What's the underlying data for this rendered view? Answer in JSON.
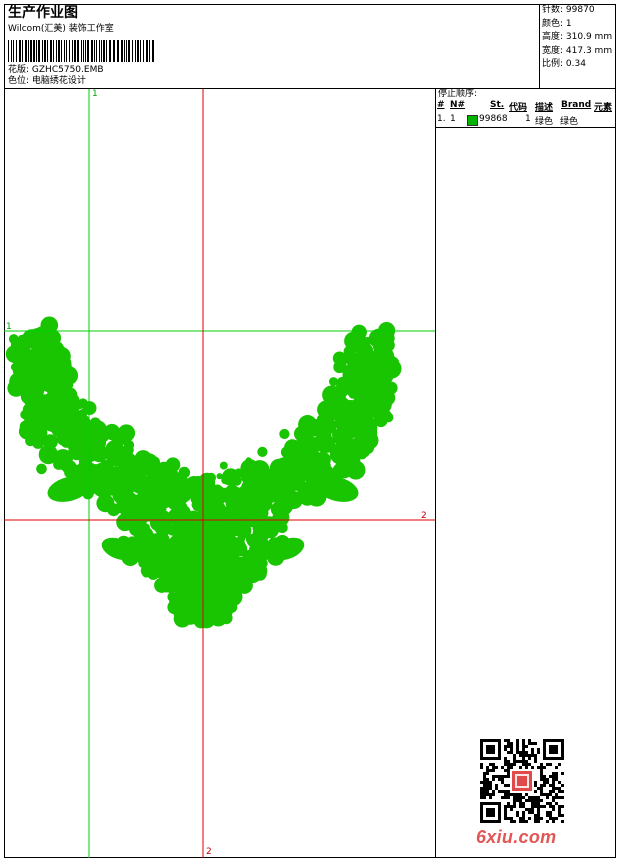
{
  "header": {
    "title": "生产作业图",
    "studio": "Wilcom(汇美) 装饰工作室",
    "pattern_label": "花版:",
    "pattern_value": "GZHC5750.EMB",
    "color_label": "色位:",
    "color_value": "电脑绣花设计"
  },
  "stats": [
    {
      "label": "针数:",
      "value": "99870"
    },
    {
      "label": "颜色:",
      "value": "1"
    },
    {
      "label": "高度:",
      "value": "310.9 mm"
    },
    {
      "label": "宽度:",
      "value": "417.3 mm"
    },
    {
      "label": "比例:",
      "value": "0.34"
    }
  ],
  "stop_sequence": {
    "title": "停止顺序:",
    "headers": [
      "#",
      "N#",
      "St.",
      "代码",
      "描述",
      "Brand",
      "元素"
    ],
    "rows": [
      {
        "index": "1.",
        "needle": "1",
        "stitches": "99868",
        "code": "1",
        "description": "绿色",
        "brand": "绿色",
        "element": "",
        "color": "#00b400"
      }
    ]
  },
  "guides": {
    "green_top": "1",
    "green_left": "1",
    "red_right": "2",
    "red_bottom": "2"
  },
  "colors": {
    "embroidery": "#19c400",
    "green_guide": "#00d000",
    "red_guide": "#e00000"
  },
  "watermark": "6xiu.com"
}
